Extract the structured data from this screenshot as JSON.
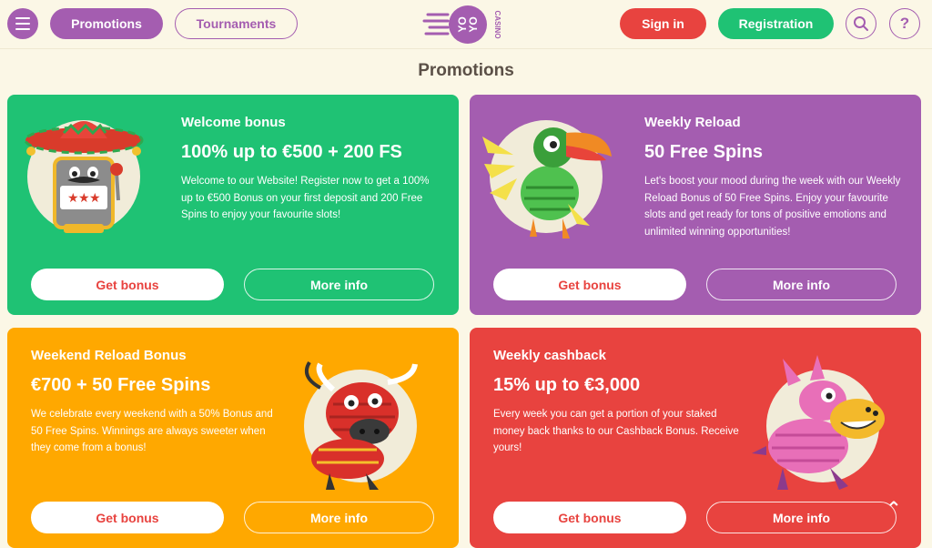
{
  "header": {
    "nav": [
      {
        "label": "Promotions",
        "active": true
      },
      {
        "label": "Tournaments",
        "active": false
      }
    ],
    "logo": {
      "text_line1": "YO",
      "text_line2": "YO",
      "text_sub": "CASINO"
    },
    "sign_in_label": "Sign in",
    "registration_label": "Registration",
    "search_icon": "search-icon",
    "help_symbol": "?"
  },
  "page": {
    "title": "Promotions"
  },
  "promotions": [
    {
      "subtitle": "Welcome bonus",
      "headline": "100% up to €500 + 200 FS",
      "description": "Welcome to our Website! Register now to get a 100% up to €500 Bonus on your first deposit and 200 Free Spins to enjoy your favourite slots!",
      "get_label": "Get bonus",
      "more_label": "More info",
      "color": "#1fc274",
      "mascot": "mariachi-slot-machine"
    },
    {
      "subtitle": "Weekly Reload",
      "headline": "50 Free Spins",
      "description": "Let's boost your mood during the week with our Weekly Reload Bonus of 50 Free Spins. Enjoy your favourite slots and get ready for tons of positive emotions and unlimited winning opportunities!",
      "get_label": "Get bonus",
      "more_label": "More info",
      "color": "#a45db0",
      "mascot": "toucan-pinata"
    },
    {
      "subtitle": "Weekend Reload Bonus",
      "headline": "€700 + 50 Free Spins",
      "description": "We celebrate every weekend with a 50% Bonus and 50 Free Spins. Winnings are always sweeter when they come from a bonus!",
      "get_label": "Get bonus",
      "more_label": "More info",
      "color": "#ffa800",
      "mascot": "bull-pinata"
    },
    {
      "subtitle": "Weekly cashback",
      "headline": "15% up to €3,000",
      "description": "Every week you can get a portion of your staked money back thanks to our Cashback Bonus. Receive yours!",
      "get_label": "Get bonus",
      "more_label": "More info",
      "color": "#e8433f",
      "mascot": "donkey-pinata"
    }
  ],
  "scroll_top_symbol": "⌃"
}
